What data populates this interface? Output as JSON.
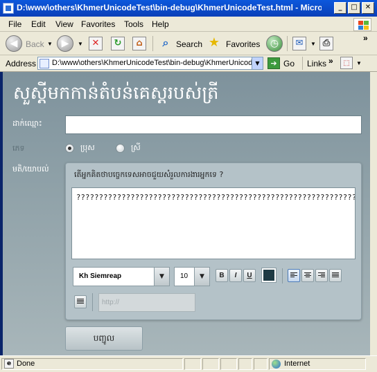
{
  "window": {
    "title": "D:\\www\\others\\KhmerUnicodeTest\\bin-debug\\KhmerUnicodeTest.html - Micros...",
    "minimize": "_",
    "maximize": "□",
    "close": "✕"
  },
  "menu": [
    "File",
    "Edit",
    "View",
    "Favorites",
    "Tools",
    "Help"
  ],
  "toolbar": {
    "back_label": "Back",
    "search_label": "Search",
    "favorites_label": "Favorites",
    "more": "»"
  },
  "address": {
    "label": "Address",
    "url": "D:\\www\\others\\KhmerUnicodeTest\\bin-debug\\KhmerUnicode",
    "go_label": "Go",
    "links_label": "Links",
    "links_more": "»"
  },
  "page": {
    "title": "សួស្តីមកកាន់តំបន់គេស្ដរបស់ត្រី",
    "name_label": "ដាក់ឈ្មោះ",
    "name_value": "",
    "gender_label": "ភេទ",
    "gender_options": [
      "ប្រុស",
      "ស្រី"
    ],
    "gender_selected": "ប្រុស",
    "comment_label": "មតិ/យោបល់",
    "question": "តើអ្នកគិតថាបច្ចេកទេសអាចជួយសំរួលការងារអ្នកទេ ?",
    "comment_text": "?????????????????????????????????????????????????????????????????????????????????????????????????????????????????????????????????????????????????????????????????????????????????????????????????????????????????????????????????????????????",
    "font_family": "Kh Siemreap",
    "font_size": "10",
    "bold_label": "B",
    "italic_label": "I",
    "underline_label": "U",
    "link_placeholder": "http://",
    "submit_label": "បញ្ជូល",
    "text_color": "#1e3a44"
  },
  "status": {
    "text": "Done",
    "zone": "Internet"
  }
}
